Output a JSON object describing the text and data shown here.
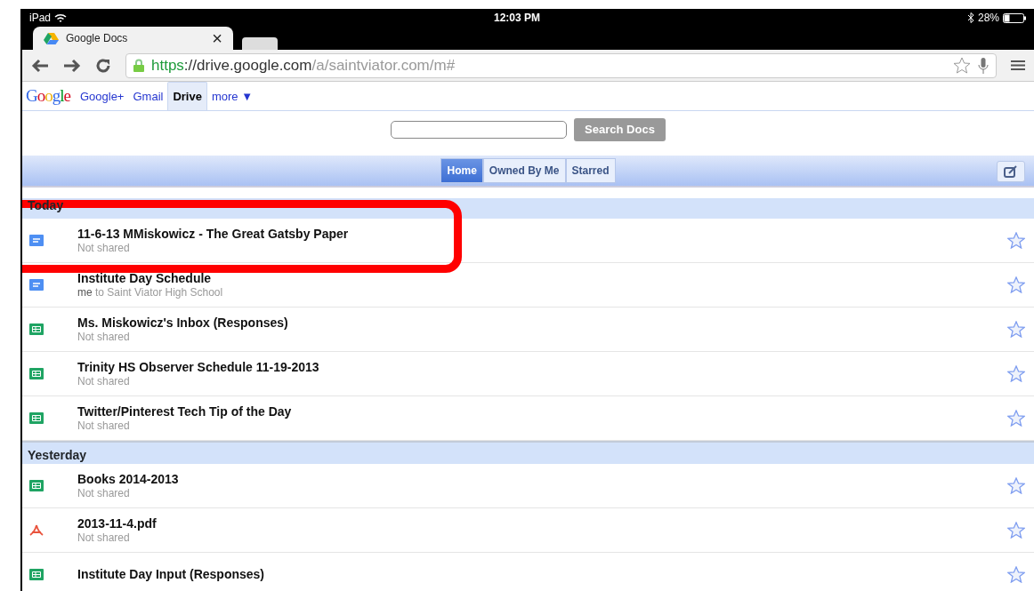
{
  "status_bar": {
    "device": "iPad",
    "time": "12:03 PM",
    "battery_text": "28%",
    "battery": {
      "level": 0.28
    }
  },
  "browser": {
    "tabs": [
      {
        "title": "Google Docs",
        "close": "×",
        "selected": true
      }
    ],
    "url": {
      "scheme": "https",
      "host": "://drive.google.com",
      "path": "/a/saintviator.com/m#"
    }
  },
  "google_bar": {
    "logo": "Google",
    "links": [
      {
        "label": "Google+",
        "selected": false
      },
      {
        "label": "Gmail",
        "selected": false
      },
      {
        "label": "Drive",
        "selected": true
      },
      {
        "label": "more ▼",
        "selected": false
      }
    ]
  },
  "search": {
    "button": "Search Docs"
  },
  "views": [
    {
      "label": "Home",
      "selected": true
    },
    {
      "label": "Owned By Me",
      "selected": false
    },
    {
      "label": "Starred",
      "selected": false
    }
  ],
  "sections": [
    {
      "title": "Today",
      "files": [
        {
          "kind": "doc",
          "name": "11-6-13 MMiskowicz - The Great Gatsby Paper",
          "sharing": "Not shared",
          "starred": false
        },
        {
          "kind": "doc",
          "name": "Institute Day Schedule",
          "sharing": "**me** to Saint Viator High School",
          "starred": false
        },
        {
          "kind": "sheet",
          "name": "Ms. Miskowicz's Inbox (Responses)",
          "sharing": "Not shared",
          "starred": false
        },
        {
          "kind": "sheet",
          "name": "Trinity HS Observer Schedule 11-19-2013",
          "sharing": "Not shared",
          "starred": false
        },
        {
          "kind": "sheet",
          "name": "Twitter/Pinterest Tech Tip of the Day",
          "sharing": "Not shared",
          "starred": false
        }
      ]
    },
    {
      "title": "Yesterday",
      "files": [
        {
          "kind": "sheet",
          "name": "Books 2014-2013",
          "sharing": "Not shared",
          "starred": false
        },
        {
          "kind": "pdf",
          "name": "2013-11-4.pdf",
          "sharing": "Not shared",
          "starred": false
        },
        {
          "kind": "sheet",
          "name": "Institute Day Input (Responses)",
          "starred": false
        }
      ]
    }
  ]
}
